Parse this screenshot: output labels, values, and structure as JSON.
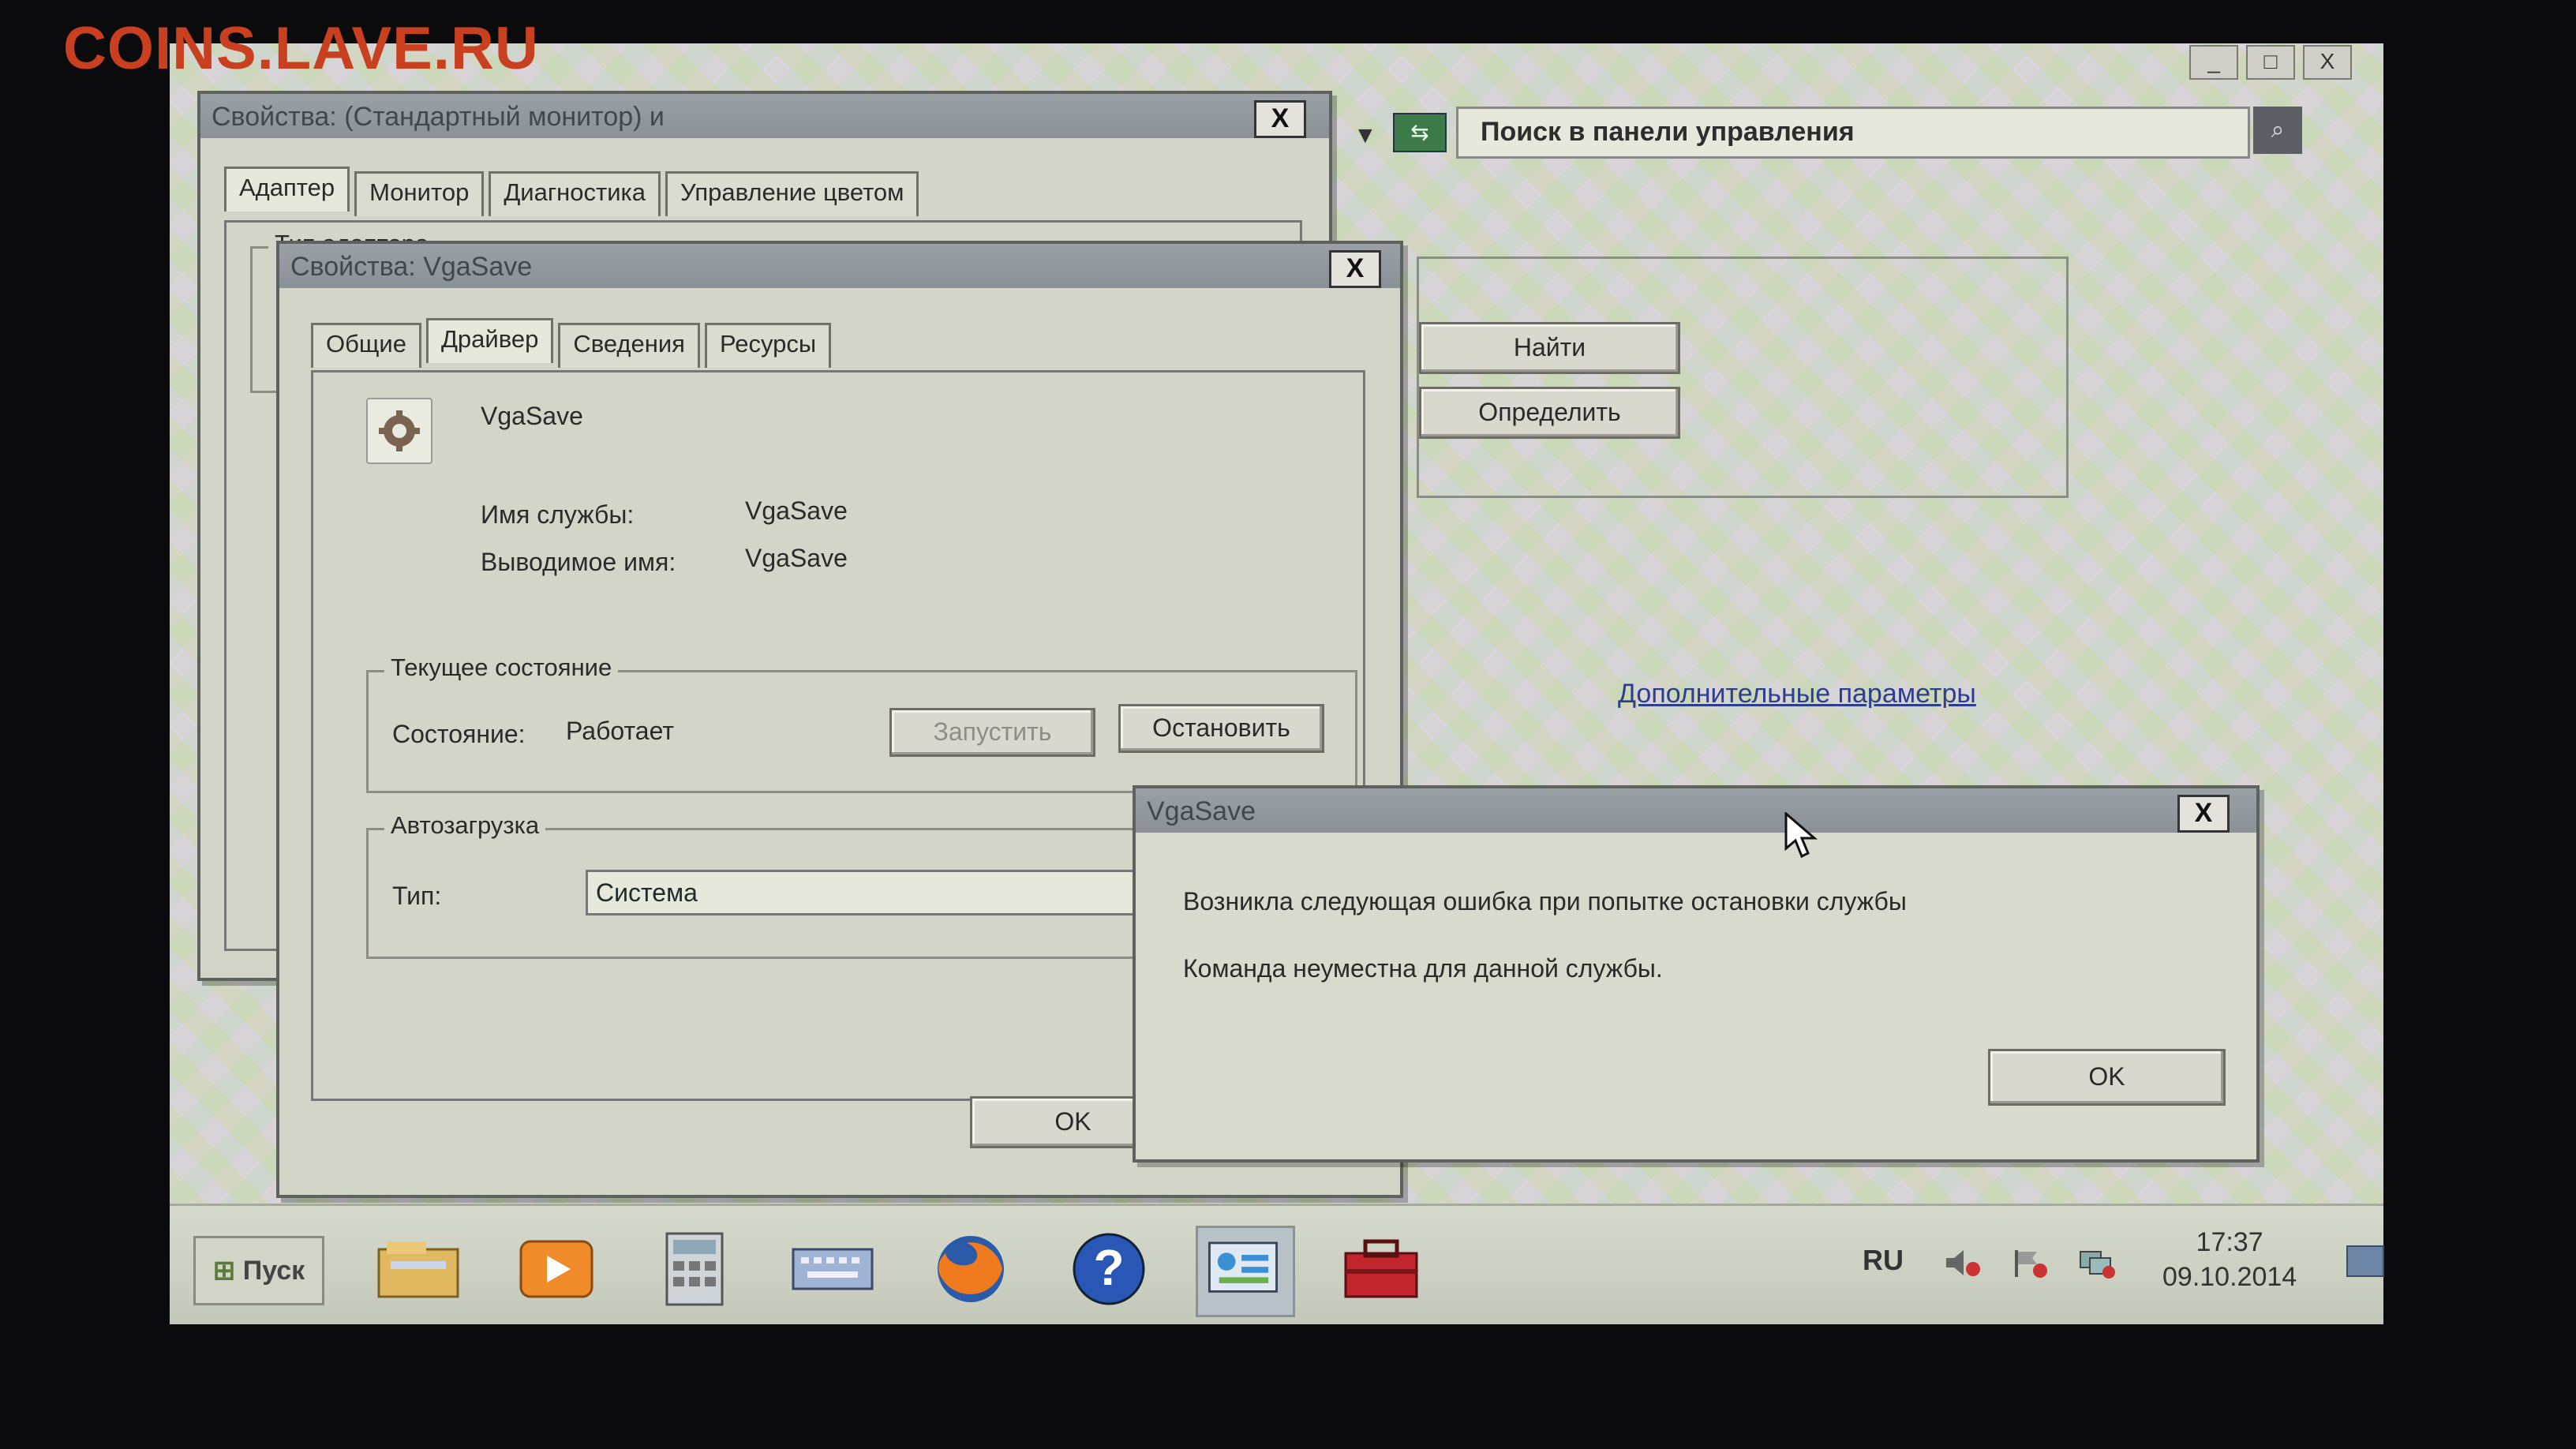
{
  "watermark": "COINS.LAVE.RU",
  "control_panel": {
    "window_buttons": [
      "_",
      "□",
      "X"
    ],
    "search_placeholder": "Поиск в панели управления",
    "find_button": "Найти",
    "detect_button": "Определить",
    "advanced_link": "Дополнительные параметры"
  },
  "monitor_dialog": {
    "title": "Свойства: (Стандартный монитор) и",
    "tabs": [
      "Адаптер",
      "Монитор",
      "Диагностика",
      "Управление цветом"
    ],
    "group_title": "Тип адаптера"
  },
  "vgasave_dialog": {
    "title": "Свойства: VgaSave",
    "tabs": [
      "Общие",
      "Драйвер",
      "Сведения",
      "Ресурсы"
    ],
    "name": "VgaSave",
    "service_name_label": "Имя службы:",
    "service_name_value": "VgaSave",
    "display_name_label": "Выводимое имя:",
    "display_name_value": "VgaSave",
    "state_group_title": "Текущее состояние",
    "state_label": "Состояние:",
    "state_value": "Работает",
    "start_button": "Запустить",
    "stop_button": "Остановить",
    "autoload_group_title": "Автозагрузка",
    "type_label": "Тип:",
    "type_value": "Система",
    "ok_button": "OK"
  },
  "error_dialog": {
    "title": "VgaSave",
    "message_line1": "Возникла следующая ошибка при попытке остановки службы",
    "message_line2": "Команда неуместна для данной службы.",
    "ok_button": "OK"
  },
  "taskbar": {
    "start_label": "Пуск",
    "language": "RU",
    "time": "17:37",
    "date": "09.10.2014",
    "apps": [
      "file-explorer-icon",
      "media-player-icon",
      "calculator-icon",
      "keyboard-icon",
      "firefox-icon",
      "help-icon",
      "control-panel-icon",
      "toolbox-icon"
    ]
  },
  "close_glyph": "X"
}
